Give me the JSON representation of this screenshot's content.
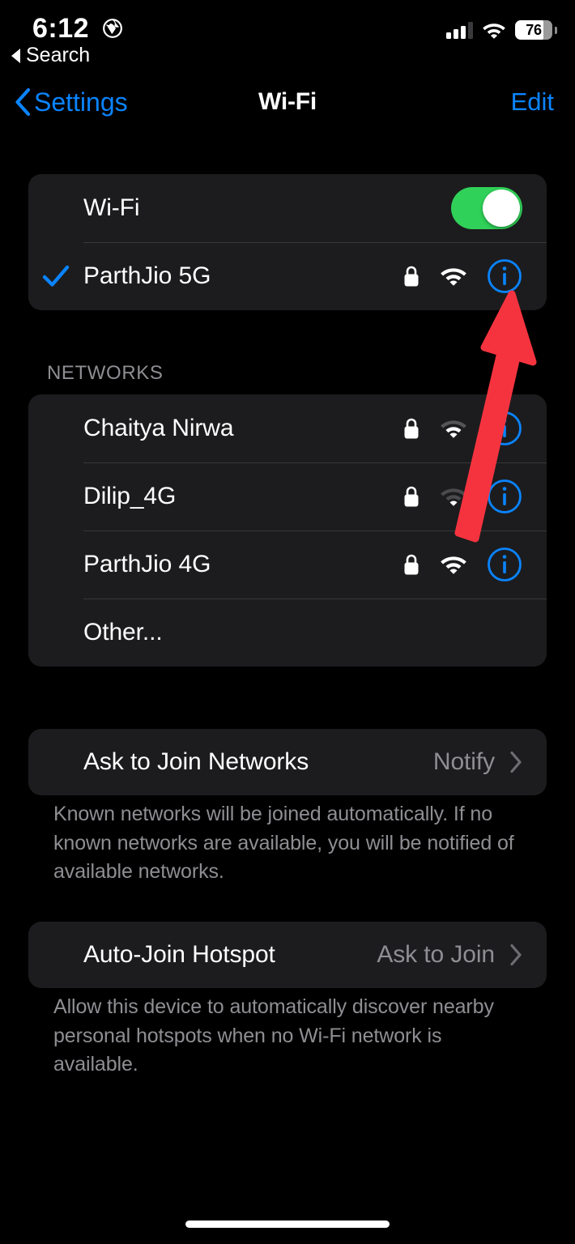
{
  "status_bar": {
    "time": "6:12",
    "location_icon": "globe-icon",
    "cellular_icon": "cellular-bars-icon",
    "wifi_icon": "wifi-icon",
    "battery_percent": "76",
    "battery_level": 76,
    "back_indicator_label": "Search",
    "back_indicator_icon": "triangle-left-icon"
  },
  "nav": {
    "back_label": "Settings",
    "back_icon": "chevron-left-icon",
    "title": "Wi-Fi",
    "edit_label": "Edit"
  },
  "wifi_section": {
    "toggle_row": {
      "label": "Wi-Fi",
      "toggle_on": true,
      "toggle_color": "#30d158"
    },
    "connected_network": {
      "name": "ParthJio 5G",
      "connected": true,
      "check_icon": "checkmark-icon",
      "lock_icon": "lock-icon",
      "wifi_icon": "wifi-icon",
      "signal_bars": 3,
      "info_icon": "info-circle-icon"
    }
  },
  "networks_section": {
    "header": "NETWORKS",
    "items": [
      {
        "name": "Chaitya Nirwa",
        "lock_icon": "lock-icon",
        "wifi_icon": "wifi-icon",
        "signal_bars": 2,
        "info_icon": "info-circle-icon"
      },
      {
        "name": "Dilip_4G",
        "lock_icon": "lock-icon",
        "wifi_icon": "wifi-icon",
        "signal_bars": 1,
        "info_icon": "info-circle-icon"
      },
      {
        "name": "ParthJio 4G",
        "lock_icon": "lock-icon",
        "wifi_icon": "wifi-icon",
        "signal_bars": 3,
        "info_icon": "info-circle-icon"
      }
    ],
    "other_label": "Other..."
  },
  "ask_to_join": {
    "label": "Ask to Join Networks",
    "value": "Notify",
    "chevron_icon": "chevron-right-icon",
    "footnote": "Known networks will be joined automatically. If no known networks are available, you will be notified of available networks."
  },
  "auto_join_hotspot": {
    "label": "Auto-Join Hotspot",
    "value": "Ask to Join",
    "chevron_icon": "chevron-right-icon",
    "footnote": "Allow this device to automatically discover nearby personal hotspots when no Wi-Fi network is available."
  },
  "annotation": {
    "type": "arrow",
    "color": "#f5333f",
    "points_to": "info-circle-icon of ParthJio 5G"
  },
  "colors": {
    "accent_blue": "#0a84ff",
    "card_bg": "#1c1c1e",
    "page_bg": "#000000",
    "secondary_text": "#8e8e93",
    "toggle_green": "#30d158",
    "arrow_red": "#f5333f"
  },
  "home_indicator": "home-indicator"
}
